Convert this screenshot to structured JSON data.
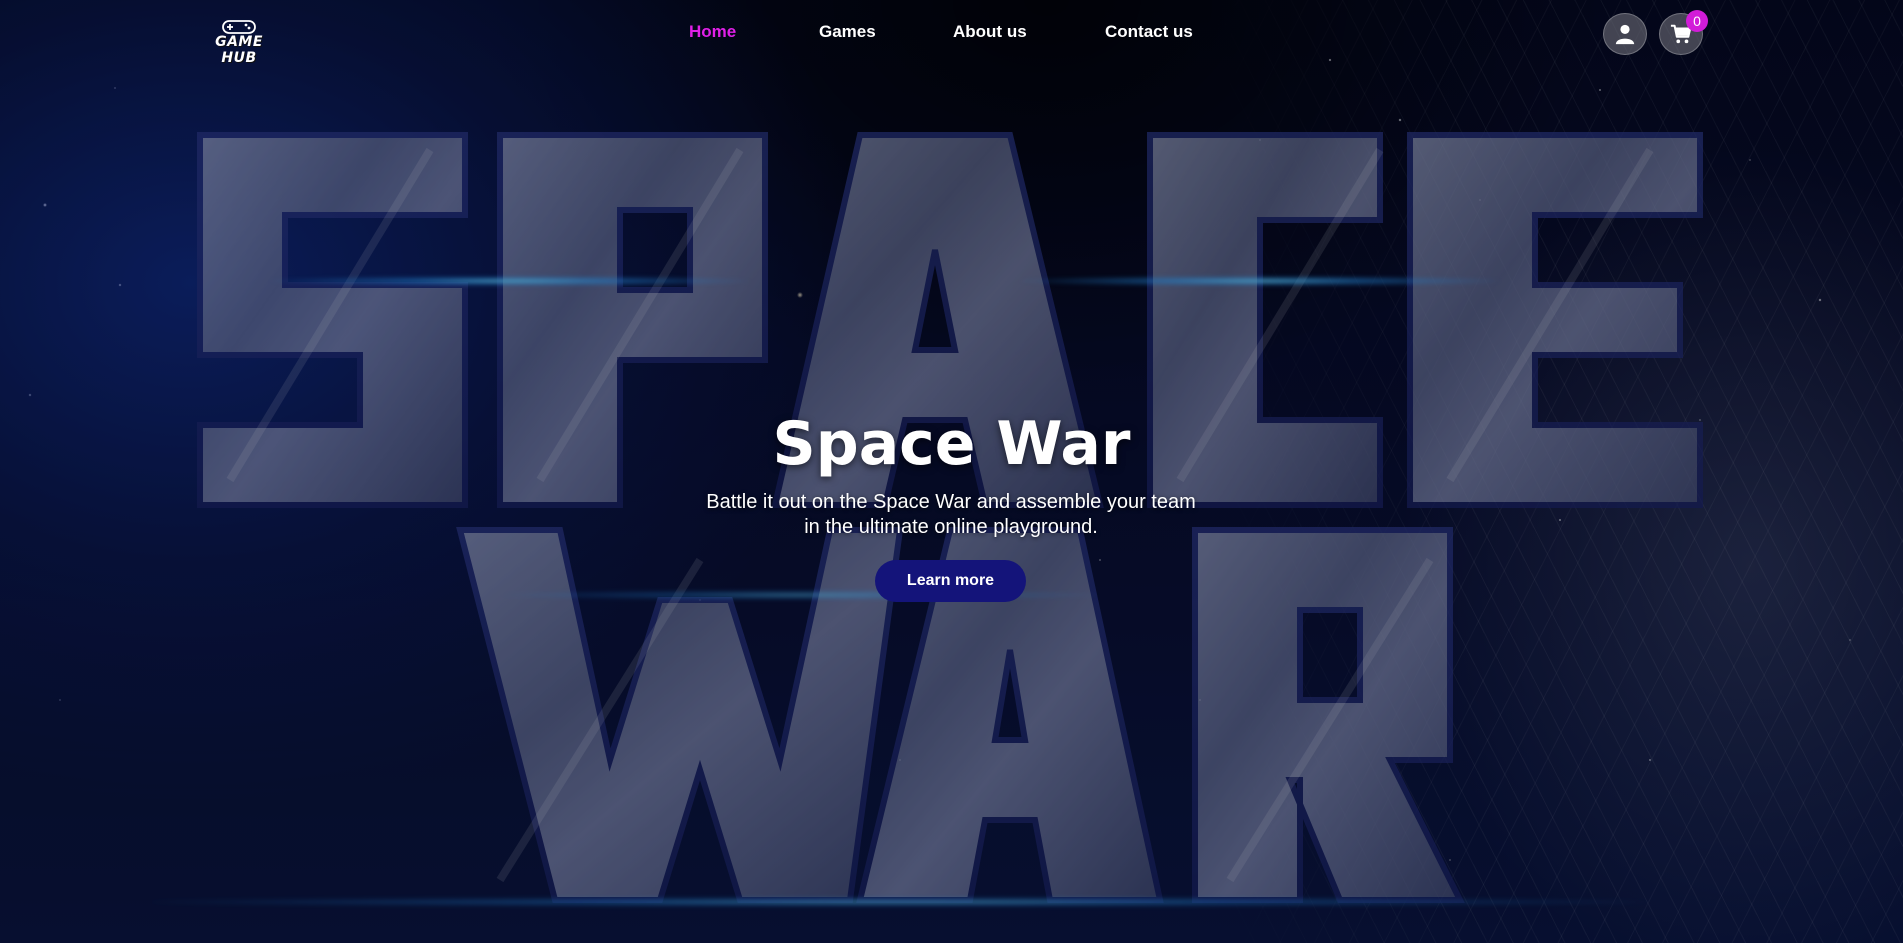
{
  "brand": {
    "logo_text": "GAME HUB",
    "logo_icon": "gamepad-icon"
  },
  "nav": {
    "items": [
      {
        "label": "Home",
        "active": true
      },
      {
        "label": "Games",
        "active": false
      },
      {
        "label": "About us",
        "active": false
      },
      {
        "label": "Contact us",
        "active": false
      }
    ],
    "active_color": "#e020e8"
  },
  "header_actions": {
    "account_icon": "user-icon",
    "cart_icon": "cart-icon",
    "cart_count": "0",
    "badge_color": "#d21cd8"
  },
  "hero": {
    "background_art_text": [
      "SPACE",
      "WAR"
    ],
    "title": "Space War",
    "subtitle": "Battle it out on the Space War and assemble your team in the ultimate online playground.",
    "cta_label": "Learn more",
    "cta_color": "#14147a"
  }
}
